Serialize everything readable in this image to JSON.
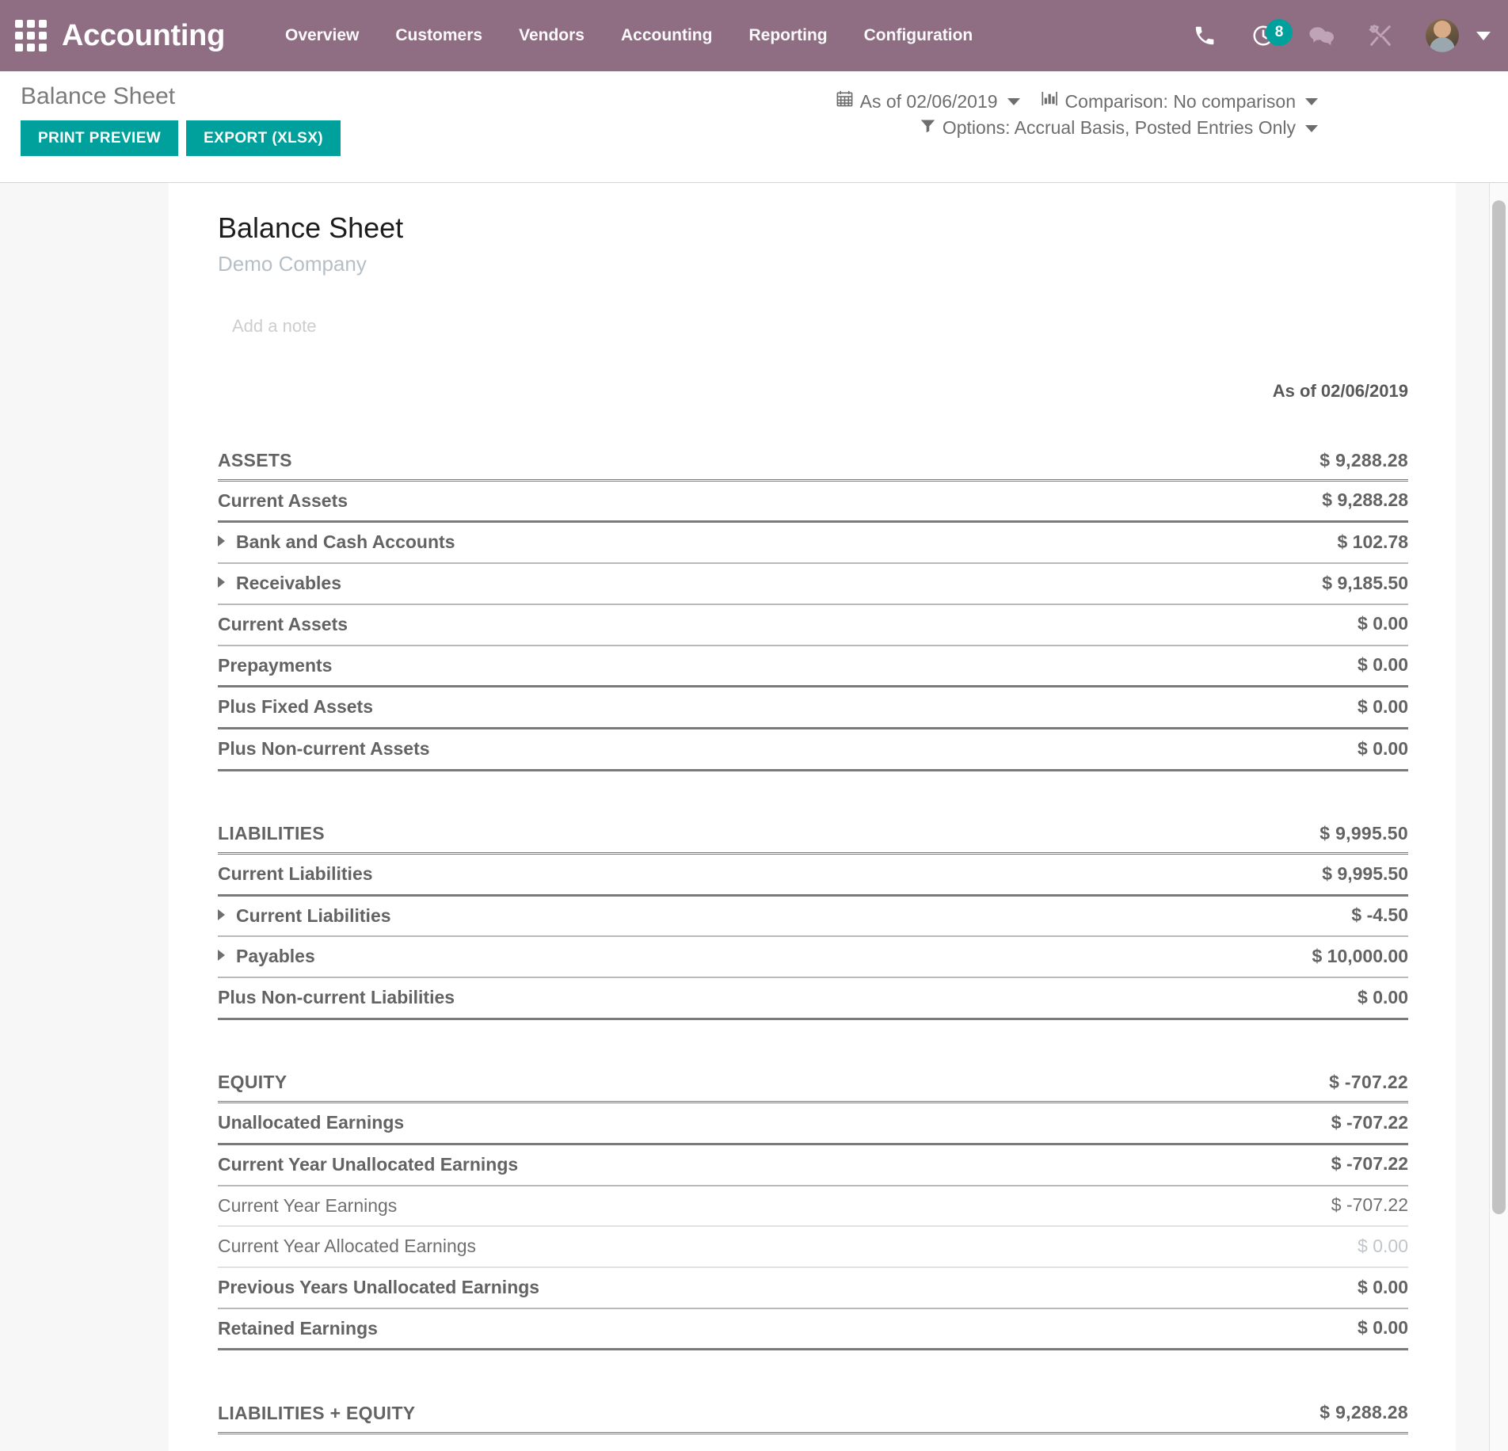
{
  "navbar": {
    "apps_icon": "apps-grid-icon",
    "brand": "Accounting",
    "menu": [
      {
        "label": "Overview"
      },
      {
        "label": "Customers"
      },
      {
        "label": "Vendors"
      },
      {
        "label": "Accounting"
      },
      {
        "label": "Reporting"
      },
      {
        "label": "Configuration"
      }
    ],
    "icons": {
      "phone": "phone-icon",
      "activity": "clock-activity-icon",
      "activity_count": "8",
      "messages": "chat-bubbles-icon",
      "tools": "wrench-screwdriver-icon",
      "avatar": "user-avatar",
      "user_caret": "chevron-down-icon"
    },
    "accent_badge_color": "#00a09d",
    "bar_color": "#8f6e84"
  },
  "control_panel": {
    "breadcrumb": "Balance Sheet",
    "print_preview_label": "PRINT PREVIEW",
    "export_label": "EXPORT (XLSX)",
    "button_color": "#00a09d",
    "filters": {
      "date": "As of 02/06/2019",
      "comparison": "Comparison: No comparison",
      "options": "Options: Accrual Basis, Posted Entries Only"
    }
  },
  "report": {
    "title": "Balance Sheet",
    "company": "Demo Company",
    "note_placeholder": "Add a note",
    "column_header": "As of 02/06/2019",
    "rows": [
      {
        "label": "ASSETS",
        "value": "$ 9,288.28",
        "level": "section",
        "indent": 0,
        "arrow": false,
        "muted_value": false
      },
      {
        "label": "Current Assets",
        "value": "$ 9,288.28",
        "level": "1",
        "indent": 0,
        "arrow": false,
        "muted_value": false
      },
      {
        "label": "Bank and Cash Accounts",
        "value": "$ 102.78",
        "level": "2",
        "indent": 1,
        "arrow": true,
        "muted_value": false
      },
      {
        "label": "Receivables",
        "value": "$ 9,185.50",
        "level": "2",
        "indent": 1,
        "arrow": true,
        "muted_value": false
      },
      {
        "label": "Current Assets",
        "value": "$ 0.00",
        "level": "2",
        "indent": 2,
        "arrow": false,
        "muted_value": false
      },
      {
        "label": "Prepayments",
        "value": "$ 0.00",
        "level": "1",
        "indent": 2,
        "arrow": false,
        "muted_value": false
      },
      {
        "label": "Plus Fixed Assets",
        "value": "$ 0.00",
        "level": "1",
        "indent": 0,
        "arrow": false,
        "muted_value": false
      },
      {
        "label": "Plus Non-current Assets",
        "value": "$ 0.00",
        "level": "1",
        "indent": 0,
        "arrow": false,
        "muted_value": false
      },
      {
        "label": "__SPACER__",
        "value": "",
        "level": "spacer",
        "indent": 0,
        "arrow": false,
        "muted_value": false
      },
      {
        "label": "LIABILITIES",
        "value": "$ 9,995.50",
        "level": "section",
        "indent": 0,
        "arrow": false,
        "muted_value": false
      },
      {
        "label": "Current Liabilities",
        "value": "$ 9,995.50",
        "level": "1",
        "indent": 0,
        "arrow": false,
        "muted_value": false
      },
      {
        "label": "Current Liabilities",
        "value": "$ -4.50",
        "level": "2",
        "indent": 1,
        "arrow": true,
        "muted_value": false
      },
      {
        "label": "Payables",
        "value": "$ 10,000.00",
        "level": "2",
        "indent": 1,
        "arrow": true,
        "muted_value": false
      },
      {
        "label": "Plus Non-current Liabilities",
        "value": "$ 0.00",
        "level": "1",
        "indent": 0,
        "arrow": false,
        "muted_value": false
      },
      {
        "label": "__SPACER__",
        "value": "",
        "level": "spacer",
        "indent": 0,
        "arrow": false,
        "muted_value": false
      },
      {
        "label": "EQUITY",
        "value": "$ -707.22",
        "level": "section",
        "indent": 0,
        "arrow": false,
        "muted_value": false
      },
      {
        "label": "Unallocated Earnings",
        "value": "$ -707.22",
        "level": "1",
        "indent": 0,
        "arrow": false,
        "muted_value": false
      },
      {
        "label": "Current Year Unallocated Earnings",
        "value": "$ -707.22",
        "level": "2",
        "indent": 1,
        "arrow": false,
        "muted_value": false
      },
      {
        "label": "Current Year Earnings",
        "value": "$ -707.22",
        "level": "3n",
        "indent": 2,
        "arrow": false,
        "muted_value": false
      },
      {
        "label": "Current Year Allocated Earnings",
        "value": "$ 0.00",
        "level": "3n",
        "indent": 2,
        "arrow": false,
        "muted_value": true
      },
      {
        "label": "Previous Years Unallocated Earnings",
        "value": "$ 0.00",
        "level": "2",
        "indent": 1,
        "arrow": false,
        "muted_value": false
      },
      {
        "label": "Retained Earnings",
        "value": "$ 0.00",
        "level": "1",
        "indent": 0,
        "arrow": false,
        "muted_value": false
      },
      {
        "label": "__SPACER__",
        "value": "",
        "level": "spacer",
        "indent": 0,
        "arrow": false,
        "muted_value": false
      },
      {
        "label": "LIABILITIES + EQUITY",
        "value": "$ 9,288.28",
        "level": "section",
        "indent": 0,
        "arrow": false,
        "muted_value": false
      }
    ]
  }
}
